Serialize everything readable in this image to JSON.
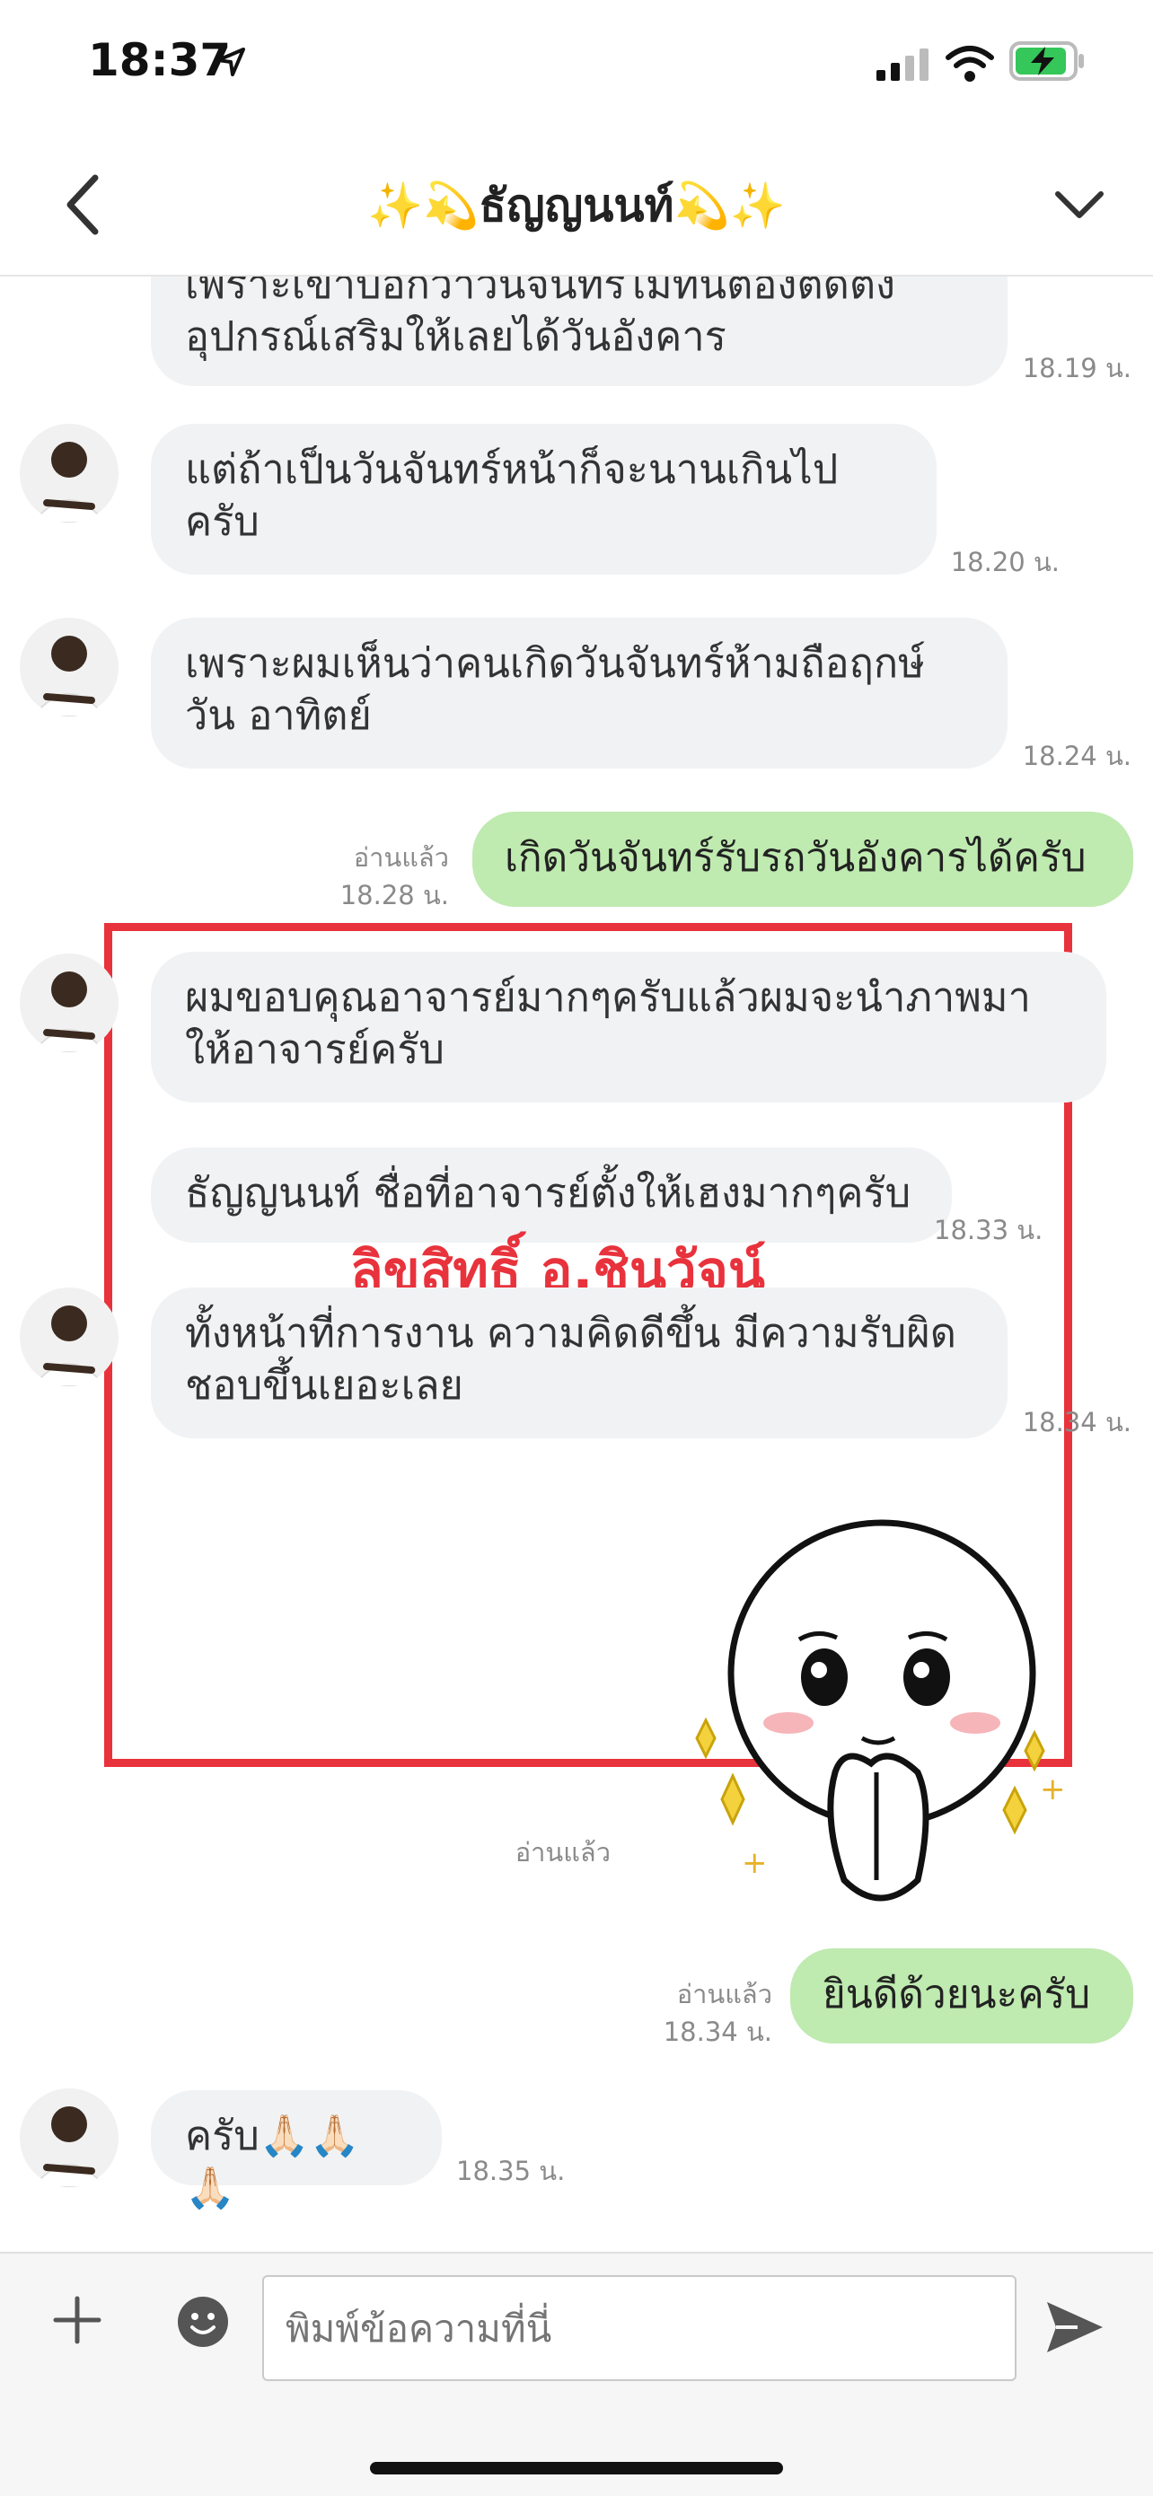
{
  "status_bar": {
    "time": "18:37"
  },
  "header": {
    "title": "✨💫ธัญญนนท์💫✨"
  },
  "messages": [
    {
      "text": "เพราะเขาบอกว่าวันจันทร์ไม่ทันต้องติดตั้ง อุปกรณ์เสริมให้เลยได้วันอังคาร",
      "time": "18.19 น."
    },
    {
      "text": "แต่ถ้าเป็นวันจันทร์หน้าก็จะนานเกินไป ครับ",
      "time": "18.20 น."
    },
    {
      "text": "เพราะผมเห็นว่าคนเกิดวันจันทร์ห้ามถือฤกษ์วัน อาทิตย์",
      "time": "18.24 น."
    },
    {
      "text": "เกิดวันจันทร์รับรถวันอังคารได้ครับ",
      "read": "อ่านแล้ว",
      "time": "18.28 น."
    },
    {
      "text": "ผมขอบคุณอาจารย์มากๆครับแล้วผมจะนำภาพมา ให้อาจารย์ครับ"
    },
    {
      "text": "ธัญญนนท์ ชื่อที่อาจารย์ตั้งให้เฮงมากๆครับ",
      "time": "18.33 น."
    },
    {
      "text": "ทั้งหน้าที่การงาน ความคิดดีขึ้น มีความรับผิด ชอบขึ้นเยอะเลย",
      "time": "18.34 น."
    },
    {
      "read": "อ่านแล้ว"
    },
    {
      "text": "ยินดีด้วยนะครับ",
      "read": "อ่านแล้ว",
      "time": "18.34 น."
    },
    {
      "text": "ครับ🙏🏻🙏🏻🙏🏻",
      "time": "18.35 น."
    }
  ],
  "watermark": "ลิขสิทธิ์ อ.ชินวัจน์",
  "input": {
    "placeholder": "พิมพ์ข้อความที่นี่"
  },
  "colors": {
    "incoming_bubble": "#f1f2f4",
    "outgoing_bubble": "#bfeab0",
    "highlight_box": "#e8323c"
  },
  "icons": [
    "location-arrow-icon",
    "signal-icon",
    "wifi-icon",
    "battery-charging-icon",
    "back-chevron-icon",
    "chevron-down-icon",
    "plus-icon",
    "emoji-icon",
    "send-icon"
  ]
}
